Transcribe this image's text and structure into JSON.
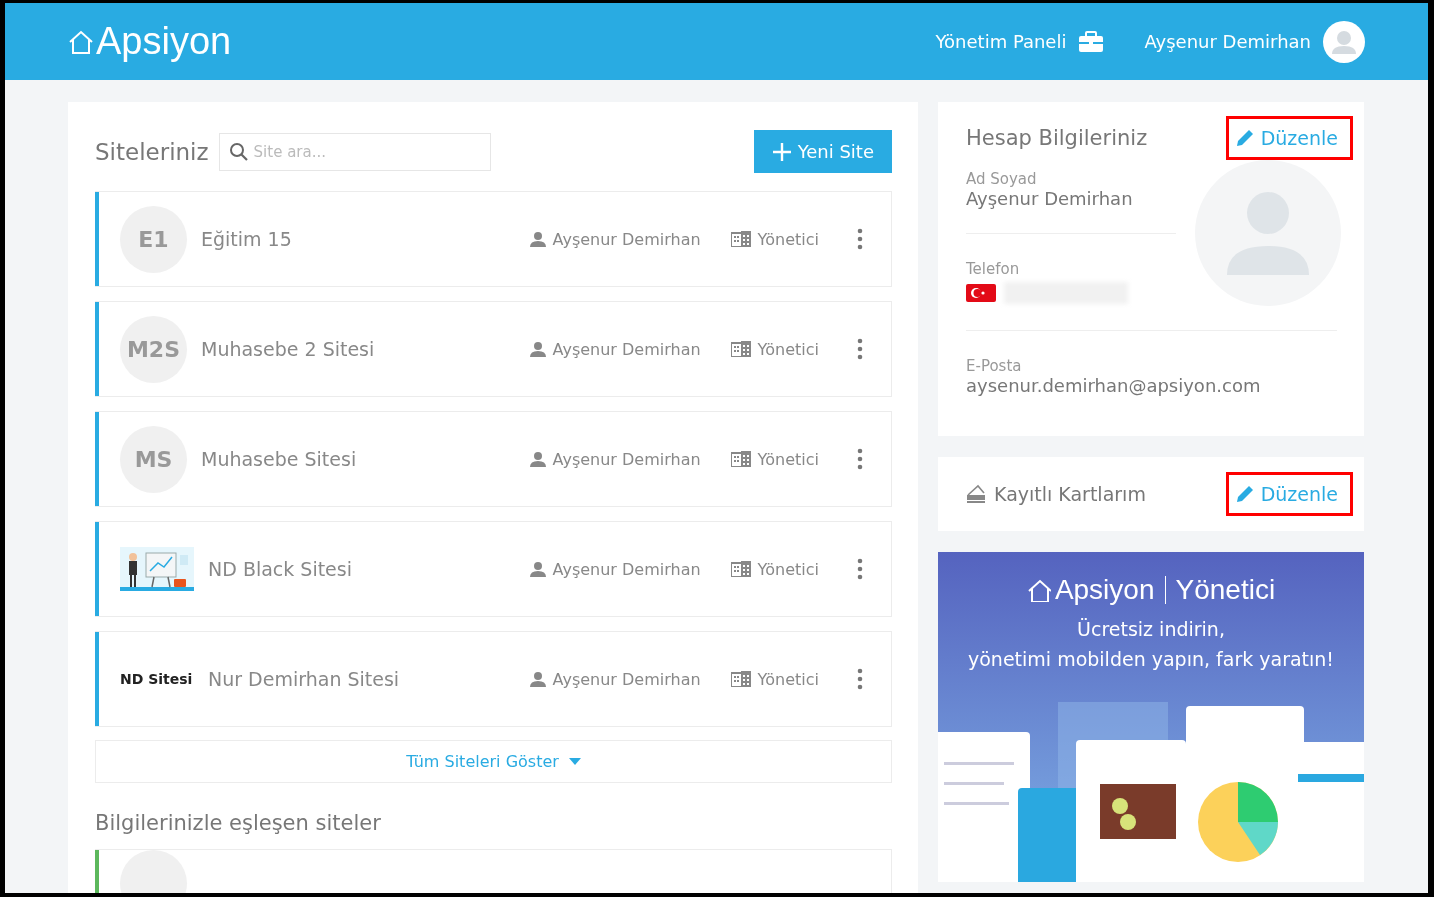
{
  "header": {
    "logo": "Apsiyon",
    "nav_link": "Yönetim Paneli",
    "user_name": "Ayşenur Demirhan"
  },
  "sites_panel": {
    "title": "Siteleriniz",
    "search": {
      "placeholder": "Site ara..."
    },
    "new_button": "Yeni Site",
    "sites": [
      {
        "kind": "initials",
        "avatar": "E1",
        "name": "Eğitim 15",
        "owner": "Ayşenur Demirhan",
        "role": "Yönetici",
        "color": "#29abe2"
      },
      {
        "kind": "initials",
        "avatar": "M2S",
        "name": "Muhasebe 2 Sitesi",
        "owner": "Ayşenur Demirhan",
        "role": "Yönetici",
        "color": "#29abe2"
      },
      {
        "kind": "initials",
        "avatar": "MS",
        "name": "Muhasebe Sitesi",
        "owner": "Ayşenur Demirhan",
        "role": "Yönetici",
        "color": "#29abe2"
      },
      {
        "kind": "picture",
        "name": "ND Black Sitesi",
        "owner": "Ayşenur Demirhan",
        "role": "Yönetici",
        "color": "#29abe2"
      },
      {
        "kind": "text_logo",
        "avatar": "ND Sitesi",
        "name": "Nur Demirhan Sitesi",
        "owner": "Ayşenur Demirhan",
        "role": "Yönetici",
        "color": "#29abe2"
      }
    ],
    "show_all": "Tüm Siteleri Göster",
    "matching_title": "Bilgilerinizle eşleşen siteler",
    "matching_sites": [
      {
        "color": "#5cb85c"
      }
    ]
  },
  "account": {
    "title": "Hesap Bilgileriniz",
    "edit_button": {
      "label": "Düzenle",
      "highlighted": true
    },
    "fields": [
      {
        "label": "Ad Soyad",
        "value": "Ayşenur Demirhan"
      },
      {
        "label": "Telefon",
        "kind": "phone"
      },
      {
        "label": "E-Posta",
        "value": "aysenur.demirhan@apsiyon.com"
      }
    ]
  },
  "cards": {
    "title": "Kayıtlı Kartlarım",
    "edit_button": {
      "label": "Düzenle",
      "highlighted": true
    }
  },
  "banner": {
    "logo": "Apsiyon",
    "product": "Yönetici",
    "lines": [
      "Ücretsiz indirin,",
      "yönetimi mobilden yapın, fark yaratın!"
    ]
  }
}
